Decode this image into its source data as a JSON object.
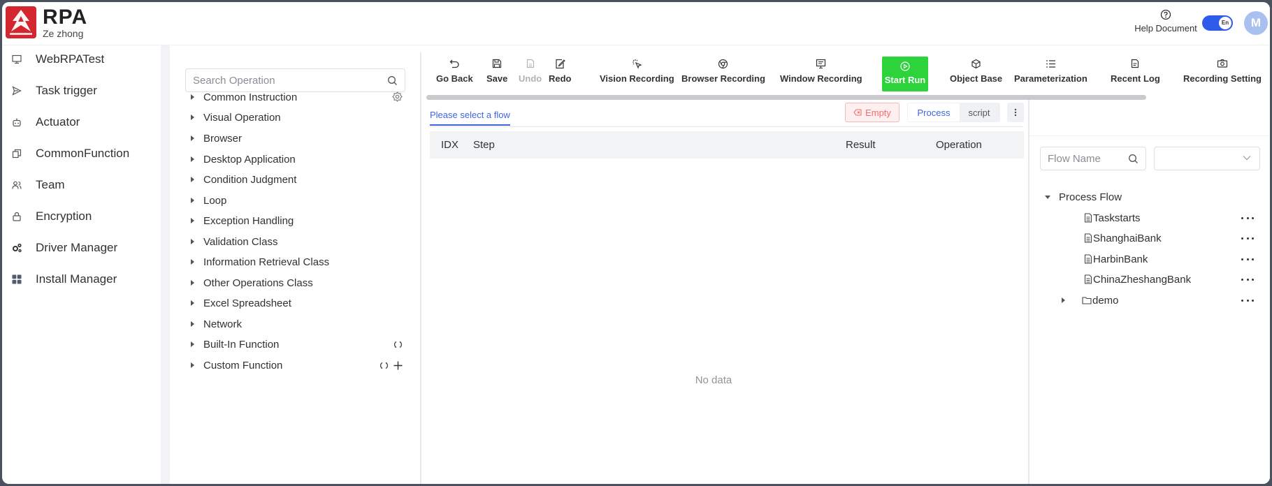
{
  "header": {
    "app_title": "RPA",
    "app_subtitle": "Ze zhong",
    "help_label": "Help Document",
    "lang_toggle": "En",
    "avatar_initial": "M"
  },
  "nav": {
    "items": [
      {
        "label": "WebRPATest",
        "icon": "monitor-icon"
      },
      {
        "label": "Task trigger",
        "icon": "send-icon"
      },
      {
        "label": "Actuator",
        "icon": "robot-icon"
      },
      {
        "label": "CommonFunction",
        "icon": "copy-icon"
      },
      {
        "label": "Team",
        "icon": "team-icon"
      },
      {
        "label": "Encryption",
        "icon": "lock-icon"
      },
      {
        "label": "Driver Manager",
        "icon": "gears-icon"
      },
      {
        "label": "Install Manager",
        "icon": "grid-icon"
      }
    ]
  },
  "operations": {
    "search_placeholder": "Search Operation",
    "items": [
      "Common Instruction",
      "Visual Operation",
      "Browser",
      "Desktop Application",
      "Condition Judgment",
      "Loop",
      "Exception Handling",
      "Validation Class",
      "Information Retrieval Class",
      "Other Operations Class",
      "Excel Spreadsheet",
      "Network",
      "Built-In Function",
      "Custom Function"
    ]
  },
  "toolbar": {
    "buttons": [
      {
        "label": "Go Back",
        "icon": "undo-arrow-icon"
      },
      {
        "label": "Save",
        "icon": "save-icon"
      },
      {
        "label": "Undo",
        "icon": "undo-doc-icon",
        "disabled": true
      },
      {
        "label": "Redo",
        "icon": "edit-icon"
      },
      {
        "label": "Vision Recording",
        "icon": "cursor-click-icon"
      },
      {
        "label": "Browser Recording",
        "icon": "chrome-icon"
      },
      {
        "label": "Window Recording",
        "icon": "window-icon"
      },
      {
        "label": "Start Run",
        "icon": "play-circle-icon",
        "primary": true
      },
      {
        "label": "Object Base",
        "icon": "cube-icon"
      },
      {
        "label": "Parameterization",
        "icon": "list-icon"
      },
      {
        "label": "Recent Log",
        "icon": "log-icon"
      },
      {
        "label": "Recording Setting",
        "icon": "camera-icon"
      }
    ]
  },
  "center": {
    "flow_tab": "Please select a flow",
    "empty_label": "Empty",
    "mode_process": "Process",
    "mode_script": "script",
    "columns": [
      "IDX",
      "Step",
      "Result",
      "Operation"
    ],
    "no_data": "No data"
  },
  "right": {
    "flow_name_placeholder": "Flow Name",
    "tree": {
      "root": "Process Flow",
      "children": [
        "Taskstarts",
        "ShanghaiBank",
        "HarbinBank",
        "ChinaZheshangBank"
      ],
      "folder": "demo"
    }
  },
  "colors": {
    "accent": "#3e63e3",
    "run": "#2cd33b",
    "logo_red": "#d4262e",
    "danger": "#f56c6c"
  }
}
